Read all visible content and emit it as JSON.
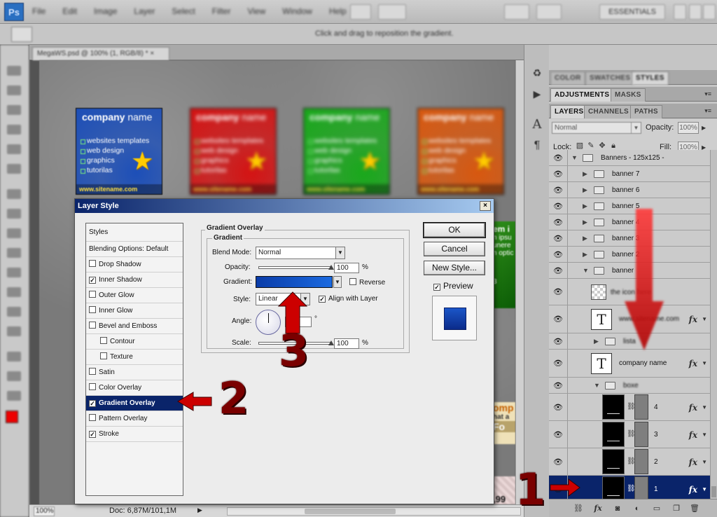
{
  "app": {
    "logo": "Ps",
    "menu": [
      "File",
      "Edit",
      "Image",
      "Layer",
      "Select",
      "Filter",
      "View",
      "Window",
      "Help"
    ],
    "workspace_label": "ESSENTIALS",
    "options_hint": "Click and drag to reposition the gradient."
  },
  "document": {
    "tab_title": "MegaWS.psd @ 100% (1, RGB/8) * ×",
    "zoom": "100%",
    "doc_size": "Doc: 6,87M/101,1M"
  },
  "banners": [
    {
      "title_bold": "company",
      "title_light": "name",
      "items": [
        "websites templates",
        "web design",
        "graphics",
        "tutorilas"
      ],
      "url": "www.sitename.com",
      "color": "#1d4fb8"
    },
    {
      "title_bold": "company",
      "title_light": "name",
      "items": [
        "websites templates",
        "web design",
        "graphics",
        "tutorilas"
      ],
      "url": "www.sitename.com",
      "color": "#d41313"
    },
    {
      "title_bold": "company",
      "title_light": "name",
      "items": [
        "websites templates",
        "web design",
        "graphics",
        "tutorilas"
      ],
      "url": "www.sitename.com",
      "color": "#19a81b"
    },
    {
      "title_bold": "company",
      "title_light": "name",
      "items": [
        "websites templates",
        "web design",
        "graphics",
        "tutorilas"
      ],
      "url": "www.sitename.com",
      "color": "#d8580f"
    }
  ],
  "peeks": {
    "green_text_1": "em i",
    "green_text_2": "n ipsu",
    "green_text_3": "unere",
    "green_text_4": "n optic",
    "green_text_5": "3",
    "orange_text_1": "omp",
    "orange_text_2": "hat a",
    "orange_text_3": "Fo",
    "price_text": ",99"
  },
  "panels": {
    "tabs_row1": [
      "COLOR",
      "SWATCHES",
      "STYLES"
    ],
    "tabs_row2": [
      "ADJUSTMENTS",
      "MASKS"
    ],
    "tabs_row3": [
      "LAYERS",
      "CHANNELS",
      "PATHS"
    ],
    "blend_mode": "Normal",
    "opacity_label": "Opacity:",
    "opacity_value": "100%",
    "lock_label": "Lock:",
    "fill_label": "Fill:",
    "fill_value": "100%"
  },
  "layers": [
    {
      "name": "Banners - 125x125 -",
      "kind": "group",
      "open": true,
      "indent": 0
    },
    {
      "name": "banner 7",
      "kind": "group",
      "open": false,
      "indent": 1
    },
    {
      "name": "banner 6",
      "kind": "group",
      "open": false,
      "indent": 1
    },
    {
      "name": "banner 5",
      "kind": "group",
      "open": false,
      "indent": 1
    },
    {
      "name": "banner 4",
      "kind": "group",
      "open": false,
      "indent": 1
    },
    {
      "name": "banner 3",
      "kind": "group",
      "open": false,
      "indent": 1
    },
    {
      "name": "banner 2",
      "kind": "group",
      "open": false,
      "indent": 1
    },
    {
      "name": "banner",
      "kind": "group",
      "open": true,
      "indent": 1
    },
    {
      "name": "the icon here",
      "kind": "smart"
    },
    {
      "name": "www.sitename.com",
      "kind": "text",
      "fx": true
    },
    {
      "name": "lista",
      "kind": "group",
      "open": false,
      "indent": 2
    },
    {
      "name": "company name",
      "kind": "text",
      "fx": true
    },
    {
      "name": "boxe",
      "kind": "group",
      "open": true,
      "indent": 2
    },
    {
      "name": "4",
      "kind": "masked",
      "fx": true
    },
    {
      "name": "3",
      "kind": "masked",
      "fx": true
    },
    {
      "name": "2",
      "kind": "masked",
      "fx": true
    },
    {
      "name": "1",
      "kind": "masked",
      "fx": true,
      "selected": true
    }
  ],
  "dialog": {
    "title": "Layer Style",
    "close": "×",
    "styles_header": "Styles",
    "blending_options": "Blending Options: Default",
    "styles": [
      {
        "label": "Drop Shadow",
        "checked": false,
        "indent": false
      },
      {
        "label": "Inner Shadow",
        "checked": true,
        "indent": false
      },
      {
        "label": "Outer Glow",
        "checked": false,
        "indent": false
      },
      {
        "label": "Inner Glow",
        "checked": false,
        "indent": false
      },
      {
        "label": "Bevel and Emboss",
        "checked": false,
        "indent": false
      },
      {
        "label": "Contour",
        "checked": false,
        "indent": true
      },
      {
        "label": "Texture",
        "checked": false,
        "indent": true
      },
      {
        "label": "Satin",
        "checked": false,
        "indent": false
      },
      {
        "label": "Color Overlay",
        "checked": false,
        "indent": false
      },
      {
        "label": "Gradient Overlay",
        "checked": true,
        "indent": false,
        "selected": true
      },
      {
        "label": "Pattern Overlay",
        "checked": false,
        "indent": false
      },
      {
        "label": "Stroke",
        "checked": true,
        "indent": false
      }
    ],
    "section_title": "Gradient Overlay",
    "subsection_title": "Gradient",
    "blend_mode_label": "Blend Mode:",
    "blend_mode_value": "Normal",
    "opacity_label": "Opacity:",
    "opacity_value": "100",
    "percent": "%",
    "gradient_label": "Gradient:",
    "reverse_label": "Reverse",
    "reverse_checked": false,
    "style_label": "Style:",
    "style_value": "Linear",
    "align_label": "Align with Layer",
    "align_checked": true,
    "angle_label": "Angle:",
    "angle_value": "",
    "degree": "°",
    "scale_label": "Scale:",
    "scale_value": "100",
    "ok_label": "OK",
    "cancel_label": "Cancel",
    "new_style_label": "New Style...",
    "preview_label": "Preview",
    "preview_checked": true,
    "opacity_fraction": 1.0,
    "scale_fraction": 1.0
  },
  "annotations": {
    "step1": "1",
    "step2": "2",
    "step3": "3",
    "arrow_color": "#cc0000"
  }
}
